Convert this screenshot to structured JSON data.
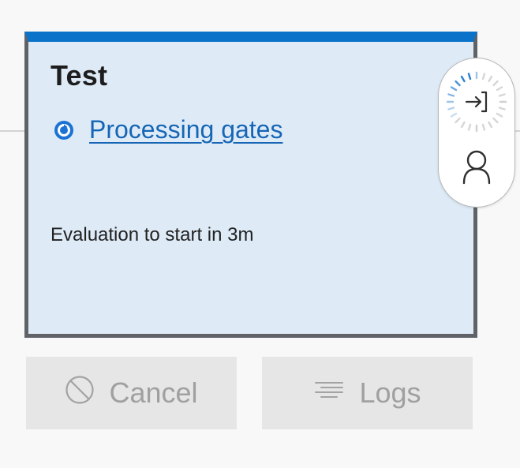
{
  "stage": {
    "title": "Test",
    "status_label": "Processing gates",
    "evaluation_text": "Evaluation to start in 3m"
  },
  "actions": {
    "cancel_label": "Cancel",
    "logs_label": "Logs"
  },
  "colors": {
    "accent": "#0a72c9",
    "card_background": "#deebf7",
    "link": "#1666b5",
    "card_border": "#5f6367",
    "disabled_button": "#e6e6e6"
  },
  "icons": {
    "status": "processing-icon",
    "pre_deployment": "pre-deployment-approval-icon",
    "approver": "person-icon",
    "cancel": "cancel-circle-icon",
    "logs": "logs-icon"
  }
}
